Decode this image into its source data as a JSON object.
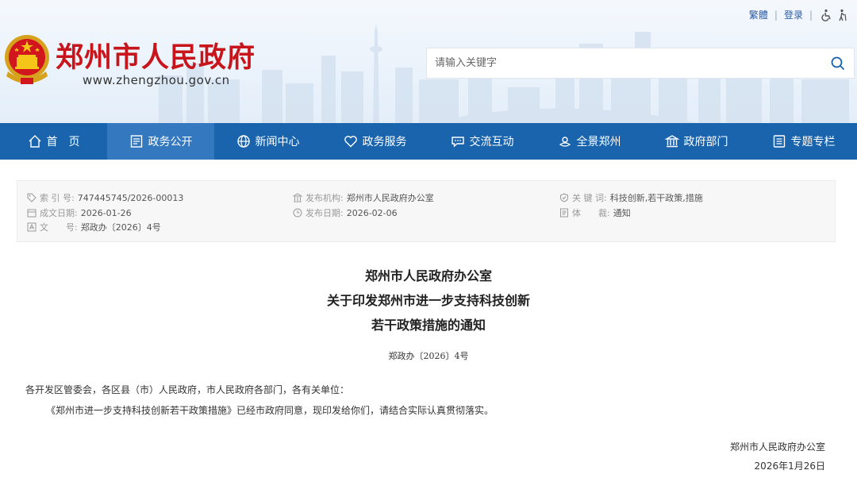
{
  "header": {
    "title": "郑州市人民政府",
    "url": "www.zhengzhou.gov.cn",
    "top_links": {
      "traditional": "繁體",
      "login": "登录"
    },
    "search": {
      "placeholder": "请输入关键字"
    }
  },
  "nav": [
    {
      "label": "首　页",
      "icon": "home-icon"
    },
    {
      "label": "政务公开",
      "icon": "document-icon",
      "active": true
    },
    {
      "label": "新闻中心",
      "icon": "globe-icon"
    },
    {
      "label": "政务服务",
      "icon": "heart-icon"
    },
    {
      "label": "交流互动",
      "icon": "chat-icon"
    },
    {
      "label": "全景郑州",
      "icon": "panorama-icon"
    },
    {
      "label": "政府部门",
      "icon": "building-icon"
    },
    {
      "label": "专题专栏",
      "icon": "list-icon"
    }
  ],
  "meta": {
    "index_label": "索 引 号:",
    "index_value": "747445745/2026-00013",
    "issuer_label": "发布机构:",
    "issuer_value": "郑州市人民政府办公室",
    "keywords_label": "关 键 词:",
    "keywords_value": "科技创新,若干政策,措施",
    "created_label": "成文日期:",
    "created_value": "2026-01-26",
    "published_label": "发布日期:",
    "published_value": "2026-02-06",
    "category_label": "体　　裁:",
    "category_value": "通知",
    "docno_label": "文　　号:",
    "docno_value": "郑政办〔2026〕4号"
  },
  "article": {
    "title_lines": [
      "郑州市人民政府办公室",
      "关于印发郑州市进一步支持科技创新",
      "若干政策措施的通知"
    ],
    "doc_number": "郑政办〔2026〕4号",
    "salutation": "各开发区管委会，各区县（市）人民政府，市人民政府各部门，各有关单位：",
    "body": "《郑州市进一步支持科技创新若干政策措施》已经市政府同意，现印发给你们，请结合实际认真贯彻落实。",
    "signature": "郑州市人民政府办公室",
    "date": "2026年1月26日"
  },
  "colors": {
    "nav_bg": "#1a64ae",
    "nav_active": "#3478bf",
    "title_red": "#c8141b",
    "link_blue": "#2b5da8"
  }
}
